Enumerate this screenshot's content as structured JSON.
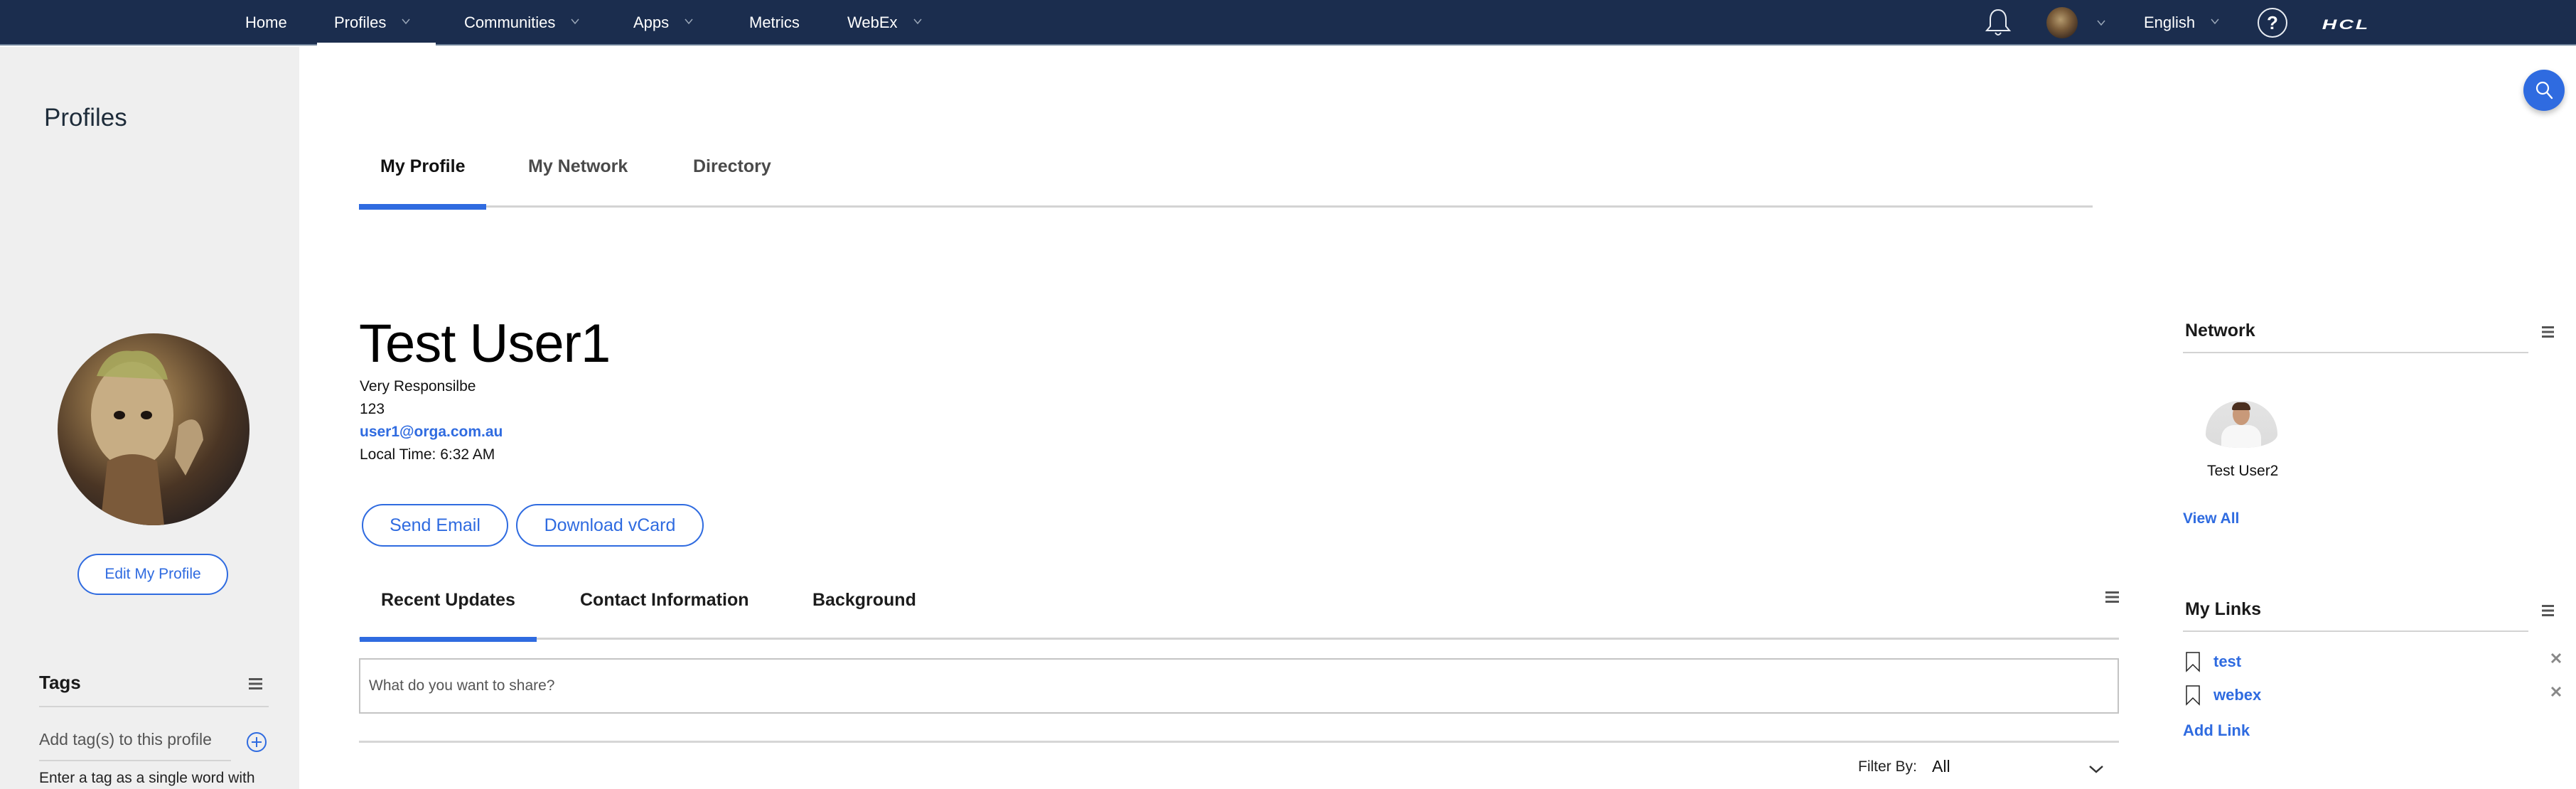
{
  "topnav": {
    "items": [
      {
        "label": "Home",
        "has_dropdown": false,
        "active": false
      },
      {
        "label": "Profiles",
        "has_dropdown": true,
        "active": true
      },
      {
        "label": "Communities",
        "has_dropdown": true,
        "active": false
      },
      {
        "label": "Apps",
        "has_dropdown": true,
        "active": false
      },
      {
        "label": "Metrics",
        "has_dropdown": false,
        "active": false
      },
      {
        "label": "WebEx",
        "has_dropdown": true,
        "active": false
      }
    ],
    "icons": {
      "notifications": "bell-icon",
      "user_menu": "avatar",
      "help": "help-icon",
      "brand": "hcl-logo"
    },
    "language": "English",
    "brand_text": "HCL"
  },
  "sidebar": {
    "title": "Profiles",
    "edit_profile_label": "Edit My Profile",
    "tags": {
      "title": "Tags",
      "add_label": "Add tag(s) to this profile",
      "help_text": "Enter a tag as a single word with"
    }
  },
  "main_tabs": [
    {
      "label": "My Profile",
      "active": true
    },
    {
      "label": "My Network",
      "active": false
    },
    {
      "label": "Directory",
      "active": false
    }
  ],
  "profile": {
    "name": "Test User1",
    "job_title": "Very Responsilbe",
    "extension": "123",
    "email": "user1@orga.com.au",
    "local_time": "Local Time: 6:32 AM",
    "send_email_label": "Send Email",
    "download_vcard_label": "Download vCard"
  },
  "sub_tabs": [
    {
      "label": "Recent Updates",
      "active": true
    },
    {
      "label": "Contact Information",
      "active": false
    },
    {
      "label": "Background",
      "active": false
    }
  ],
  "feed": {
    "share_placeholder": "What do you want to share?",
    "filter_label": "Filter By:",
    "filter_value": "All"
  },
  "network": {
    "title": "Network",
    "members": [
      {
        "name": "Test User2"
      }
    ],
    "view_all_label": "View All"
  },
  "my_links": {
    "title": "My Links",
    "links": [
      {
        "label": "test"
      },
      {
        "label": "webex"
      }
    ],
    "add_label": "Add Link"
  },
  "colors": {
    "nav_bg": "#1b2d4e",
    "accent": "#2f6be0",
    "sidebar_bg": "#efefef"
  }
}
